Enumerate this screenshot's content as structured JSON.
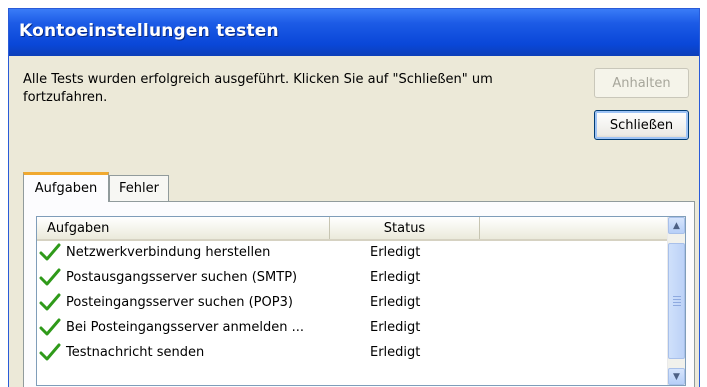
{
  "window": {
    "title": "Kontoeinstellungen testen"
  },
  "message": "Alle Tests wurden erfolgreich ausgeführt. Klicken Sie auf \"Schließen\" um fortzufahren.",
  "buttons": {
    "stop_label": "Anhalten",
    "close_label": "Schließen"
  },
  "tabs": [
    {
      "label": "Aufgaben",
      "active": true
    },
    {
      "label": "Fehler",
      "active": false
    }
  ],
  "table": {
    "columns": [
      "Aufgaben",
      "Status"
    ],
    "rows": [
      {
        "task": "Netzwerkverbindung herstellen",
        "status": "Erledigt"
      },
      {
        "task": "Postausgangsserver suchen (SMTP)",
        "status": "Erledigt"
      },
      {
        "task": "Posteingangsserver suchen (POP3)",
        "status": "Erledigt"
      },
      {
        "task": "Bei Posteingangsserver anmelden ...",
        "status": "Erledigt"
      },
      {
        "task": "Testnachricht senden",
        "status": "Erledigt"
      }
    ]
  },
  "icons": {
    "row_icon": "check-icon",
    "scroll_up": "arrow-up-icon",
    "scroll_down": "arrow-down-icon"
  },
  "colors": {
    "titlebar": "#0a47d8",
    "check": "#2f9a1a",
    "tab_highlight": "#f0a930"
  }
}
